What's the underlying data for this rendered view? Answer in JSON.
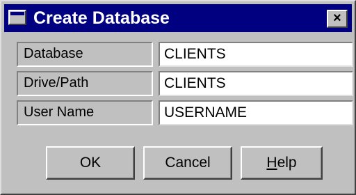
{
  "window": {
    "title": "Create Database",
    "close_label": "×",
    "title_icon": "window-icon"
  },
  "fields": [
    {
      "label": "Database",
      "value": "CLIENTS"
    },
    {
      "label": "Drive/Path",
      "value": "CLIENTS"
    },
    {
      "label": "User Name",
      "value": "USERNAME"
    }
  ],
  "buttons": {
    "ok": "OK",
    "cancel": "Cancel",
    "help_mnemonic": "H",
    "help_rest": "elp"
  },
  "colors": {
    "titlebar": "#000080",
    "face": "#c0c0c0"
  }
}
